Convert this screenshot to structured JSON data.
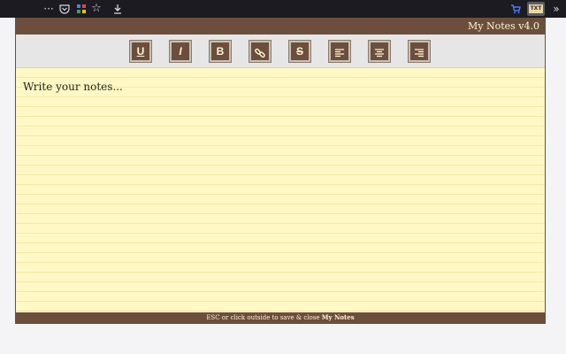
{
  "browser": {
    "more_icon": "ellipsis-icon",
    "pocket_icon": "pocket-icon",
    "extension_icon": "extension-icon",
    "bookmark_icon": "star-icon",
    "download_icon": "download-icon",
    "cart_icon": "cart-icon",
    "notes_extension_label": "TXT",
    "overflow_icon": "chevron-double-right-icon"
  },
  "popup": {
    "title": "My Notes v4.0",
    "placeholder": "Write your notes...",
    "footer_prefix": "ESC or click outside to save & close ",
    "footer_app_name": "My Notes",
    "colors": {
      "bar": "#6b4f3c",
      "paper": "#fff8c4",
      "toolbar_bg": "#e6e6e6"
    }
  },
  "format_toolbar": {
    "buttons": [
      {
        "label": "U",
        "icon": "underline-icon"
      },
      {
        "label": "I",
        "icon": "italic-icon"
      },
      {
        "label": "B",
        "icon": "bold-icon"
      },
      {
        "label": "",
        "icon": "link-icon"
      },
      {
        "label": "S",
        "icon": "strikethrough-icon"
      },
      {
        "label": "",
        "icon": "align-left-icon"
      },
      {
        "label": "",
        "icon": "align-center-icon"
      },
      {
        "label": "",
        "icon": "align-right-icon"
      }
    ]
  }
}
